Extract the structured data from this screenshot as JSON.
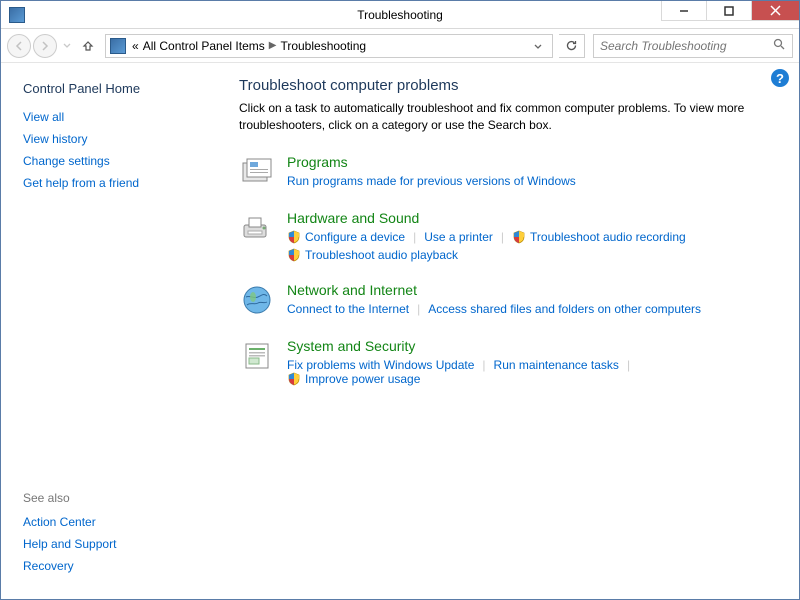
{
  "window": {
    "title": "Troubleshooting"
  },
  "breadcrumb": {
    "prefix": "«",
    "parent": "All Control Panel Items",
    "current": "Troubleshooting"
  },
  "search": {
    "placeholder": "Search Troubleshooting"
  },
  "sidebar": {
    "heading": "Control Panel Home",
    "links": [
      "View all",
      "View history",
      "Change settings",
      "Get help from a friend"
    ],
    "see_also_label": "See also",
    "see_also": [
      "Action Center",
      "Help and Support",
      "Recovery"
    ]
  },
  "main": {
    "heading": "Troubleshoot computer problems",
    "description": "Click on a task to automatically troubleshoot and fix common computer problems. To view more troubleshooters, click on a category or use the Search box.",
    "categories": [
      {
        "title": "Programs",
        "tasks": [
          {
            "label": "Run programs made for previous versions of Windows",
            "shield": false
          }
        ]
      },
      {
        "title": "Hardware and Sound",
        "tasks": [
          {
            "label": "Configure a device",
            "shield": true
          },
          {
            "label": "Use a printer",
            "shield": false
          },
          {
            "label": "Troubleshoot audio recording",
            "shield": true
          },
          {
            "label": "Troubleshoot audio playback",
            "shield": true,
            "newline": true
          }
        ]
      },
      {
        "title": "Network and Internet",
        "tasks": [
          {
            "label": "Connect to the Internet",
            "shield": false
          },
          {
            "label": "Access shared files and folders on other computers",
            "shield": false
          }
        ]
      },
      {
        "title": "System and Security",
        "tasks": [
          {
            "label": "Fix problems with Windows Update",
            "shield": false
          },
          {
            "label": "Run maintenance tasks",
            "shield": false
          },
          {
            "label": "Improve power usage",
            "shield": true
          }
        ]
      }
    ]
  }
}
